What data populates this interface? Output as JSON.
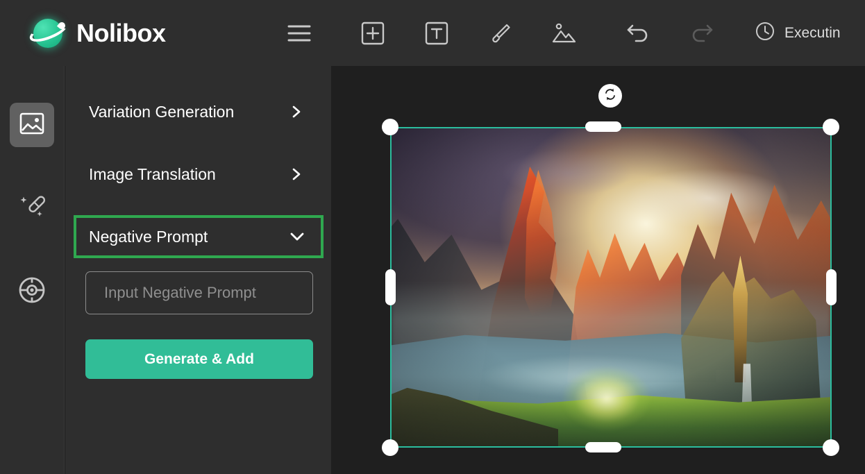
{
  "app": {
    "brand_name": "Nolibox",
    "logo_color": "#2dd2a0",
    "accent_color": "#31bd97",
    "highlight_color": "#2fa84f",
    "selection_color": "#2bbd9e"
  },
  "topbar": {
    "tools": [
      {
        "name": "menu-icon",
        "label": "Menu"
      },
      {
        "name": "add-icon",
        "label": "Add"
      },
      {
        "name": "text-icon",
        "label": "Text"
      },
      {
        "name": "brush-icon",
        "label": "Brush"
      },
      {
        "name": "image-icon",
        "label": "Image"
      },
      {
        "name": "undo-icon",
        "label": "Undo"
      },
      {
        "name": "redo-icon",
        "label": "Redo"
      }
    ],
    "status": {
      "icon": "clock-icon",
      "text": "Executin"
    }
  },
  "rail": {
    "items": [
      {
        "name": "sidebar-item-image",
        "icon": "image-icon",
        "label": "Image",
        "active": true
      },
      {
        "name": "sidebar-item-magic",
        "icon": "magic-wand-icon",
        "label": "Magic",
        "active": false
      },
      {
        "name": "sidebar-item-target",
        "icon": "target-icon",
        "label": "Target",
        "active": false
      }
    ]
  },
  "panel": {
    "sections": [
      {
        "label": "Variation Generation",
        "chevron": "chevron-right-icon",
        "expanded": false,
        "highlighted": false
      },
      {
        "label": "Image Translation",
        "chevron": "chevron-right-icon",
        "expanded": false,
        "highlighted": false
      },
      {
        "label": "Negative Prompt",
        "chevron": "chevron-down-icon",
        "expanded": true,
        "highlighted": true
      }
    ],
    "negative_prompt_input": {
      "value": "",
      "placeholder": "Input Negative Prompt"
    },
    "generate_button_label": "Generate & Add"
  },
  "canvas": {
    "selected_object": {
      "type": "image",
      "description": "Fantasy landscape painting with fiery orange mountain peaks, glowing golden sky, a blue-teal valley lake, a luminous green meadow and an elven village with spired towers and a waterfall on the right",
      "rotate_handle": "rotate-icon",
      "handles": [
        "top-left",
        "top-center",
        "top-right",
        "middle-left",
        "middle-right",
        "bottom-left",
        "bottom-center",
        "bottom-right"
      ]
    }
  }
}
